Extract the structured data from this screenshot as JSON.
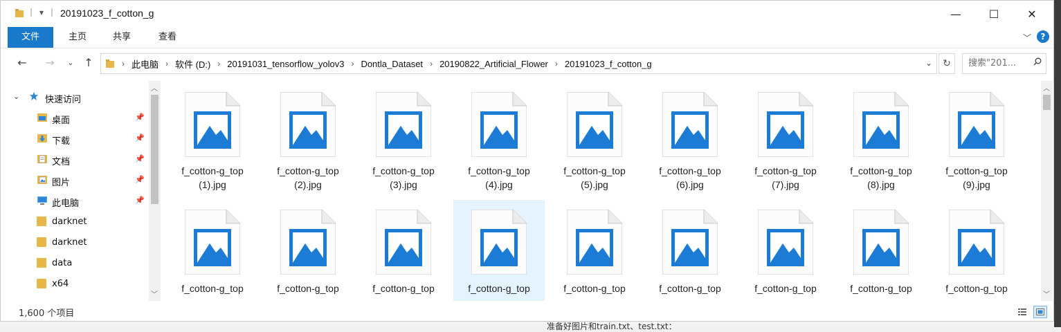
{
  "window": {
    "title": "20191023_f_cotton_g",
    "buttons": {
      "minimize": "—",
      "maximize": "☐",
      "close": "✕"
    }
  },
  "ribbon": {
    "tabs": [
      "文件",
      "主页",
      "共享",
      "查看"
    ],
    "accent": "#1979ca",
    "help": "?"
  },
  "address": {
    "crumbs": [
      "此电脑",
      "软件 (D:)",
      "20191031_tensorflow_yolov3",
      "Dontla_Dataset",
      "20190822_Artificial_Flower",
      "20191023_f_cotton_g"
    ]
  },
  "search": {
    "placeholder": "搜索\"201..."
  },
  "navpane": {
    "quick_access": "快速访问",
    "items": [
      {
        "label": "桌面",
        "icon": "desktop-icon",
        "pinned": true
      },
      {
        "label": "下载",
        "icon": "download-icon",
        "pinned": true
      },
      {
        "label": "文档",
        "icon": "documents-icon",
        "pinned": true
      },
      {
        "label": "图片",
        "icon": "pictures-icon",
        "pinned": true
      },
      {
        "label": "此电脑",
        "icon": "computer-icon",
        "pinned": true
      },
      {
        "label": "darknet",
        "icon": "folder-icon",
        "pinned": false
      },
      {
        "label": "darknet",
        "icon": "folder-icon",
        "pinned": false
      },
      {
        "label": "data",
        "icon": "folder-icon",
        "pinned": false
      },
      {
        "label": "x64",
        "icon": "folder-icon",
        "pinned": false
      }
    ]
  },
  "files": {
    "row1": [
      {
        "line1": "f_cotton-g_top",
        "line2": "(1).jpg"
      },
      {
        "line1": "f_cotton-g_top",
        "line2": "(2).jpg"
      },
      {
        "line1": "f_cotton-g_top",
        "line2": "(3).jpg"
      },
      {
        "line1": "f_cotton-g_top",
        "line2": "(4).jpg"
      },
      {
        "line1": "f_cotton-g_top",
        "line2": "(5).jpg"
      },
      {
        "line1": "f_cotton-g_top",
        "line2": "(6).jpg"
      },
      {
        "line1": "f_cotton-g_top",
        "line2": "(7).jpg"
      },
      {
        "line1": "f_cotton-g_top",
        "line2": "(8).jpg"
      },
      {
        "line1": "f_cotton-g_top",
        "line2": "(9).jpg"
      }
    ],
    "row2": [
      {
        "line1": "f_cotton-g_top",
        "selected": false
      },
      {
        "line1": "f_cotton-g_top",
        "selected": false
      },
      {
        "line1": "f_cotton-g_top",
        "selected": false
      },
      {
        "line1": "f_cotton-g_top",
        "selected": true
      },
      {
        "line1": "f_cotton-g_top",
        "selected": false
      },
      {
        "line1": "f_cotton-g_top",
        "selected": false
      },
      {
        "line1": "f_cotton-g_top",
        "selected": false
      },
      {
        "line1": "f_cotton-g_top",
        "selected": false
      },
      {
        "line1": "f_cotton-g_top",
        "selected": false
      }
    ]
  },
  "status": {
    "count": "1,600 个项目"
  },
  "background_text": "准备好图片和train.txt、test.txt："
}
